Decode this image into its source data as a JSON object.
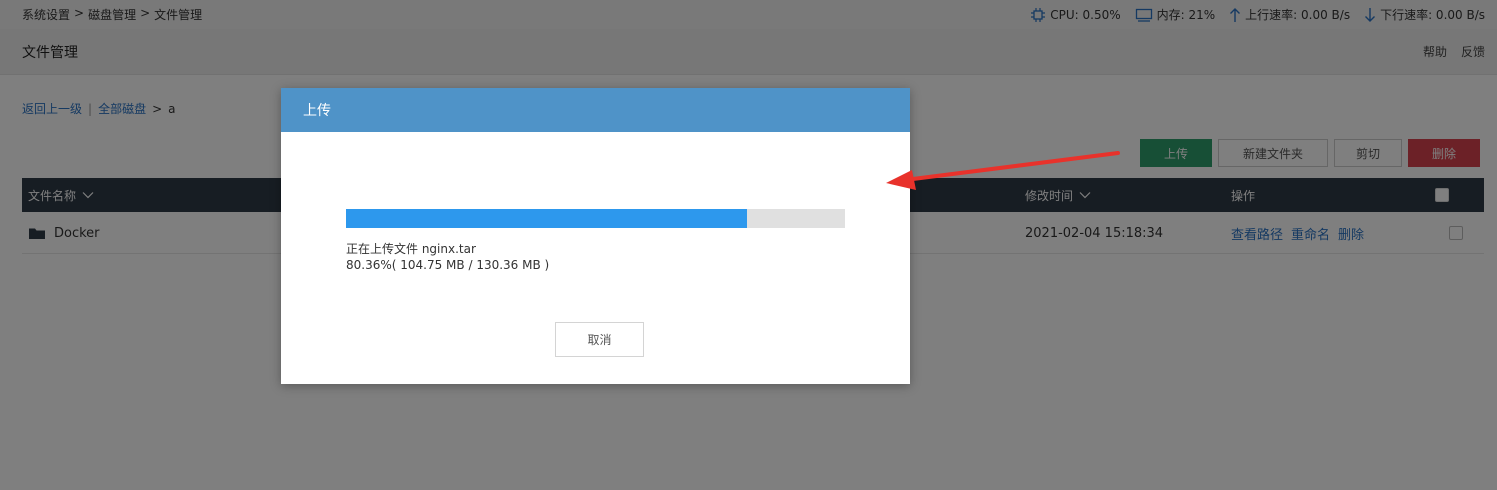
{
  "topbar": {
    "breadcrumb": [
      "系统设置",
      ">",
      "磁盘管理",
      ">",
      "文件管理"
    ],
    "cpu": "CPU: 0.50%",
    "memory": "内存: 21%",
    "upload_speed": "上行速率: 0.00 B/s",
    "download_speed": "下行速率: 0.00 B/s"
  },
  "header": {
    "title": "文件管理",
    "help": "帮助",
    "feedback": "反馈"
  },
  "path": {
    "back": "返回上一级",
    "separator": "|",
    "all_disks": "全部磁盘",
    "arrow": ">",
    "current": "a"
  },
  "toolbar": {
    "upload": "上传",
    "new_folder": "新建文件夹",
    "cut": "剪切",
    "delete": "删除"
  },
  "table": {
    "columns": {
      "name": "文件名称",
      "modified": "修改时间",
      "actions": "操作"
    },
    "rows": [
      {
        "name": "Docker",
        "modified": "2021-02-04 15:18:34",
        "view_path": "查看路径",
        "rename": "重命名",
        "delete": "删除"
      }
    ]
  },
  "dialog": {
    "title": "上传",
    "status": "正在上传文件 nginx.tar",
    "detail": "80.36%( 104.75 MB / 130.36 MB )",
    "progress": 0.8036,
    "cancel": "取消"
  },
  "colors": {
    "accent_blue": "#4f93c8",
    "progress_blue": "#2d98ed",
    "upload_green": "#2e9e6c",
    "delete_red": "#d9434f",
    "table_header": "#2f3a47",
    "arrow_red": "#e8322b"
  }
}
